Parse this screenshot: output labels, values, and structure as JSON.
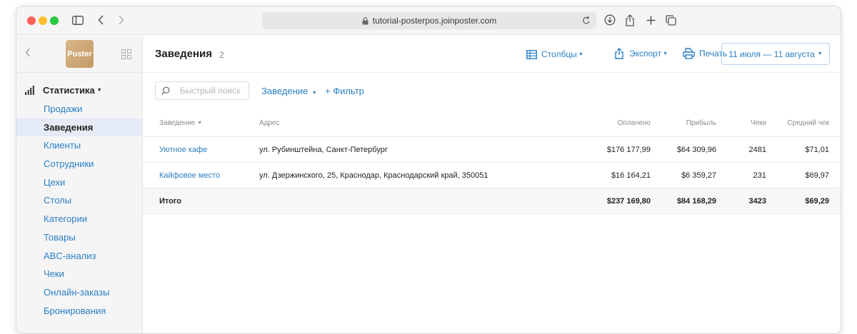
{
  "browser": {
    "url": "tutorial-posterpos.joinposter.com"
  },
  "sidebar": {
    "logo_text": "Poster",
    "section_label": "Статистика",
    "items": [
      {
        "label": "Продажи"
      },
      {
        "label": "Заведения"
      },
      {
        "label": "Клиенты"
      },
      {
        "label": "Сотрудники"
      },
      {
        "label": "Цехи"
      },
      {
        "label": "Столы"
      },
      {
        "label": "Категории"
      },
      {
        "label": "Товары"
      },
      {
        "label": "ABC-анализ"
      },
      {
        "label": "Чеки"
      },
      {
        "label": "Онлайн-заказы"
      },
      {
        "label": "Бронирования"
      }
    ],
    "active_index": 1
  },
  "header": {
    "title": "Заведения",
    "count": "2",
    "columns_label": "Столбцы",
    "export_label": "Экспорт",
    "print_label": "Печать",
    "date_range": "11 июля — 11 августа"
  },
  "filters": {
    "search_placeholder": "Быстрый поиск",
    "venue_label": "Заведение",
    "add_filter_label": "+ Фильтр"
  },
  "table": {
    "columns": [
      "Заведение",
      "Адрес",
      "Оплачено",
      "Прибыль",
      "Чеки",
      "Средний чек"
    ],
    "rows": [
      {
        "name": "Уютное кафе",
        "address": "ул. Рубинштейна, Санкт-Петербург",
        "paid": "$176 177,99",
        "profit": "$64 309,96",
        "checks": "2481",
        "avg": "$71,01"
      },
      {
        "name": "Кайфовое место",
        "address": "ул. Дзержинского, 25, Краснодар, Краснодарский край, 350051",
        "paid": "$16 164,21",
        "profit": "$6 359,27",
        "checks": "231",
        "avg": "$69,97"
      }
    ],
    "total": {
      "label": "Итого",
      "paid": "$237 169,80",
      "profit": "$84 168,29",
      "checks": "3423",
      "avg": "$69,29"
    }
  },
  "colors": {
    "accent": "#2a7fc4",
    "active_bg": "#e4ebf6"
  }
}
